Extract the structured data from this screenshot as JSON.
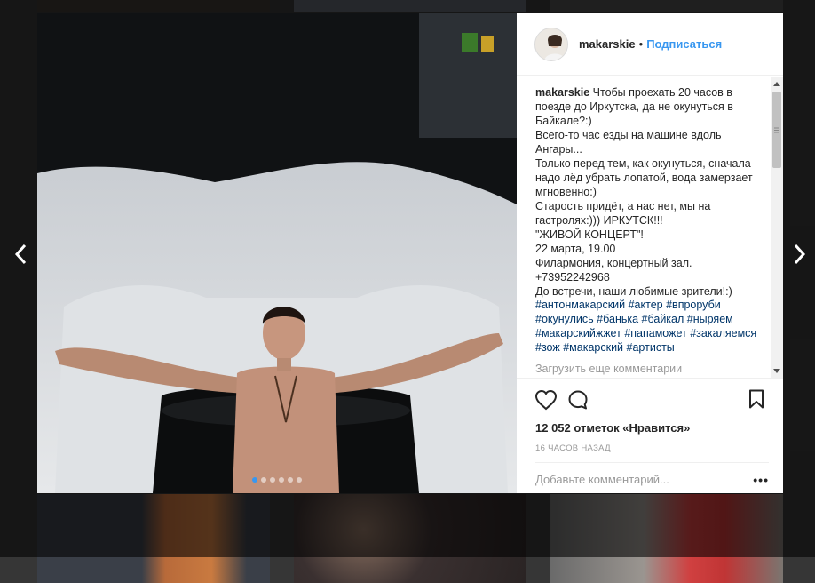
{
  "post": {
    "username": "makarskie",
    "separator": "•",
    "follow_label": "Подписаться",
    "caption_username": "makarskie",
    "caption_text": "Чтобы проехать 20 часов в поезде до Иркутска, да не окунуться в Байкале?:)\nВсего-то час езды на машине вдоль Ангары...\nТолько перед тем, как окунуться, сначала надо лёд убрать лопатой, вода замерзает мгновенно:)\nСтарость придёт, а нас нет, мы на гастролях:))) ИРКУТСК!!!\n\"ЖИВОЙ КОНЦЕРТ\"!\n22 марта, 19.00\nФилармония, концертный зал.\n+73952242968\nДо встречи, наши любимые зрители!:)",
    "hashtags": [
      "#антонмакарский",
      "#актер",
      "#впроруби",
      "#окунулись",
      "#банька",
      "#байкал",
      "#ныряем",
      "#макарскийжжет",
      "#папаможет",
      "#закаляемся",
      "#зож",
      "#макарский",
      "#артисты"
    ],
    "load_more_label": "Загрузить еще комментарии",
    "likes_label": "12 052 отметок «Нравится»",
    "time_label": "16 ЧАСОВ НАЗАД",
    "comment_placeholder": "Добавьте комментарий...",
    "more_label": "•••",
    "carousel": {
      "count": 6,
      "active_index": 0
    }
  },
  "icons": {
    "prev": "chevron-left-icon",
    "next": "chevron-right-icon",
    "like": "heart-outline-icon",
    "comment": "speech-bubble-icon",
    "save": "bookmark-icon"
  },
  "colors": {
    "link": "#3897f0",
    "hashtag": "#003569",
    "muted": "#999999",
    "text": "#262626"
  }
}
